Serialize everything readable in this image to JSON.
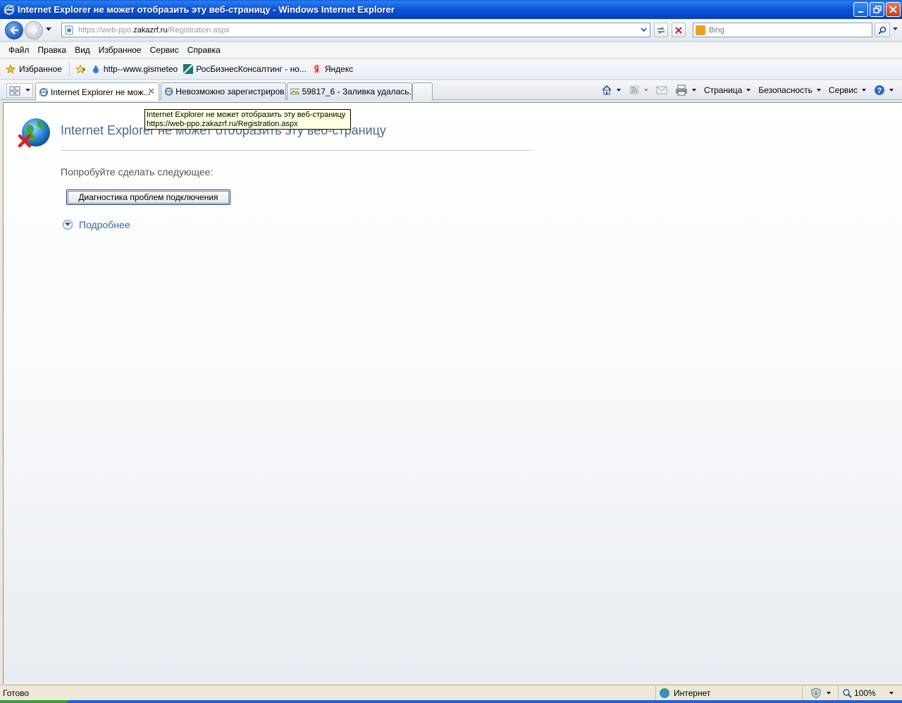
{
  "window": {
    "title": "Internet Explorer не может отобразить эту веб-страницу - Windows Internet Explorer"
  },
  "address": {
    "url_prefix": "https://web-ppo.",
    "url_domain": "zakazrf.ru",
    "url_suffix": "/Registration.aspx"
  },
  "search": {
    "placeholder": "Bing"
  },
  "menu": {
    "items": [
      "Файл",
      "Правка",
      "Вид",
      "Избранное",
      "Сервис",
      "Справка"
    ]
  },
  "favorites": {
    "main_label": "Избранное",
    "items": [
      {
        "label": "http--www.gismeteo",
        "icon": "droplet-icon"
      },
      {
        "label": "РосБизнесКонсалтинг - но...",
        "icon": "rbc-icon"
      },
      {
        "label": "Яндекс",
        "icon": "yandex-icon"
      }
    ]
  },
  "tabs": [
    {
      "label": "Internet Explorer не мож...",
      "icon": "ie-icon",
      "active": true
    },
    {
      "label": "Невозможно зарегистриров...",
      "icon": "ie-icon",
      "active": false
    },
    {
      "label": "59817_6 - Заливка удалась...",
      "icon": "photo-icon",
      "active": false
    }
  ],
  "commandbar": {
    "page": "Страница",
    "safety": "Безопасность",
    "tools": "Сервис"
  },
  "tooltip": {
    "line1": "Internet Explorer не может отобразить эту веб-страницу",
    "line2": "https://web-ppo.zakazrf.ru/Registration.aspx"
  },
  "content": {
    "title": "Internet Explorer не может отобразить эту веб-страницу",
    "try_text": "Попробуйте сделать следующее:",
    "diagnose_button": "Диагностика проблем подключения",
    "more_link": "Подробнее"
  },
  "status": {
    "text": "Готово",
    "zone": "Интернет",
    "zoom": "100%"
  },
  "colors": {
    "titlebar": "#0c58d6",
    "error_title": "#4a6a90",
    "link": "#2d6aa3"
  }
}
